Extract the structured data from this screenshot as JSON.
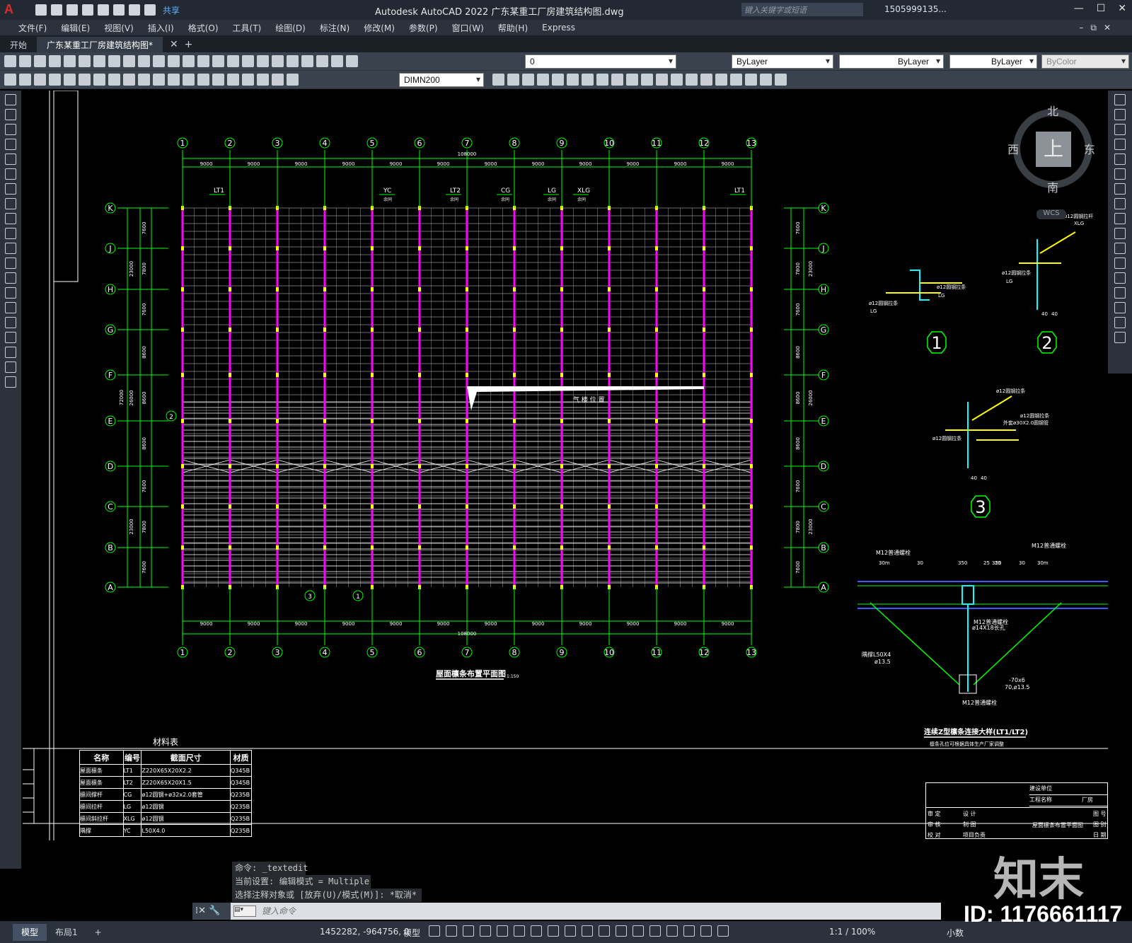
{
  "app": {
    "title": "Autodesk AutoCAD 2022    广东某重工厂房建筑结构图.dwg",
    "share_label": "共享",
    "search_placeholder": "键入关键字或短语",
    "user": "1505999135...",
    "logo": "A"
  },
  "menu": [
    "文件(F)",
    "编辑(E)",
    "视图(V)",
    "插入(I)",
    "格式(O)",
    "工具(T)",
    "绘图(D)",
    "标注(N)",
    "修改(M)",
    "参数(P)",
    "窗口(W)",
    "帮助(H)",
    "Express"
  ],
  "tabs": [
    {
      "label": "开始",
      "active": false
    },
    {
      "label": "广东某重工厂房建筑结构图*",
      "active": true
    }
  ],
  "toolbar": {
    "layer_value": "0",
    "color": "ByLayer",
    "linetype": "ByLayer",
    "lineweight": "ByLayer",
    "plotstyle": "ByColor",
    "dimstyle": "DIMN200"
  },
  "viewcube": {
    "north": "北",
    "south": "南",
    "east": "东",
    "west": "西",
    "face": "上",
    "wcs": "WCS"
  },
  "drawing": {
    "grid_cols": [
      "1",
      "2",
      "3",
      "4",
      "5",
      "6",
      "7",
      "8",
      "9",
      "10",
      "11",
      "12",
      "13"
    ],
    "grid_rows": [
      "K",
      "J",
      "H",
      "G",
      "F",
      "E",
      "D",
      "C",
      "B",
      "A"
    ],
    "span_label": "9000",
    "total_width": "108000",
    "left_dims": [
      "7600",
      "7800",
      "7600",
      "8600",
      "8600",
      "8600",
      "7600",
      "7800",
      "7600"
    ],
    "left_group_dims": [
      "23000",
      "26000",
      "23000"
    ],
    "total_depth": "72000",
    "member_tags": [
      "LT1",
      "YC",
      "LT2",
      "CG",
      "LG",
      "XLG",
      "LT1"
    ],
    "member_sub": [
      "余同",
      "余同",
      "余同",
      "余同",
      "余同"
    ],
    "plan_title": "屋面檩条布置平面图",
    "plan_scale": "1:150",
    "skylight_label": "气 楼 位 置",
    "detail_markers": [
      "1",
      "2",
      "3"
    ],
    "detail1_labels": [
      "ø12圆钢拉条",
      "ø12圆钢拉条",
      "LG",
      "LG"
    ],
    "detail2_labels": [
      "ø12圆钢拉杆",
      "XLG",
      "ø12圆钢拉条",
      "LG",
      "40",
      "40"
    ],
    "detail3_labels": [
      "ø12圆钢拉条",
      "ø12圆钢拉条",
      "外套ø30X2.0圆钢管",
      "ø12圆钢拉条",
      "40",
      "40"
    ],
    "conn_labels": [
      "M12普通螺栓",
      "M12普通螺栓",
      "M12普通螺栓",
      "M12普通螺栓",
      "ø14X18长孔",
      "隅撑L50X4",
      "ø13.5",
      "-70x6",
      "70,ø13.5"
    ],
    "conn_dims": [
      "30m",
      "30",
      "350",
      "350",
      "30",
      "30m",
      "25",
      "25"
    ],
    "conn_title": "连续Z型檩条连接大样(LT1/LT2)",
    "conn_note": "檩条孔位可根据具体生产厂家调整"
  },
  "material_table": {
    "title": "材料表",
    "headers": [
      "名称",
      "编号",
      "截面尺寸",
      "材质"
    ],
    "rows": [
      [
        "屋面檩条",
        "LT1",
        "Z220X65X20X2.2",
        "Q345B"
      ],
      [
        "屋面檩条",
        "LT2",
        "Z220X65X20X1.5",
        "Q345B"
      ],
      [
        "檩间撑杆",
        "CG",
        "ø12圆钢+ø32x2.0套管",
        "Q235B"
      ],
      [
        "檩间拉杆",
        "LG",
        "ø12圆钢",
        "Q235B"
      ],
      [
        "檩间斜拉杆",
        "XLG",
        "ø12圆钢",
        "Q235B"
      ],
      [
        "隅撑",
        "YC",
        "L50X4.0",
        "Q235B"
      ]
    ]
  },
  "title_block": {
    "rows": [
      [
        "审 定",
        "设 计"
      ],
      [
        "审 核",
        "制 图"
      ],
      [
        "校 对",
        "项目负责"
      ]
    ],
    "drawing_name": "屋面檩条布置平面图",
    "project_label": "建设单位",
    "project_name": "工程名称",
    "unit": "厂房",
    "cols_right": [
      "图 号",
      "图 别",
      "日 期"
    ]
  },
  "command": {
    "history": [
      "命令: _textedit",
      "当前设置: 编辑模式 = Multiple",
      "选择注释对象或 [放弃(U)/模式(M)]: *取消*"
    ],
    "placeholder": "键入命令"
  },
  "status": {
    "layouts": [
      "模型",
      "布局1"
    ],
    "coords": "1452282, -964756, 0",
    "mode": "模型",
    "scale": "1:1 / 100%",
    "units": "小数"
  },
  "watermark": {
    "logo": "知末",
    "id": "ID: 1176661117"
  },
  "colors": {
    "grid_green": "#00ff00",
    "purlin_magenta": "#ff00ff",
    "line_white": "#ffffff",
    "detail_cyan": "#00ffff",
    "detail_yellow": "#ffff00"
  }
}
